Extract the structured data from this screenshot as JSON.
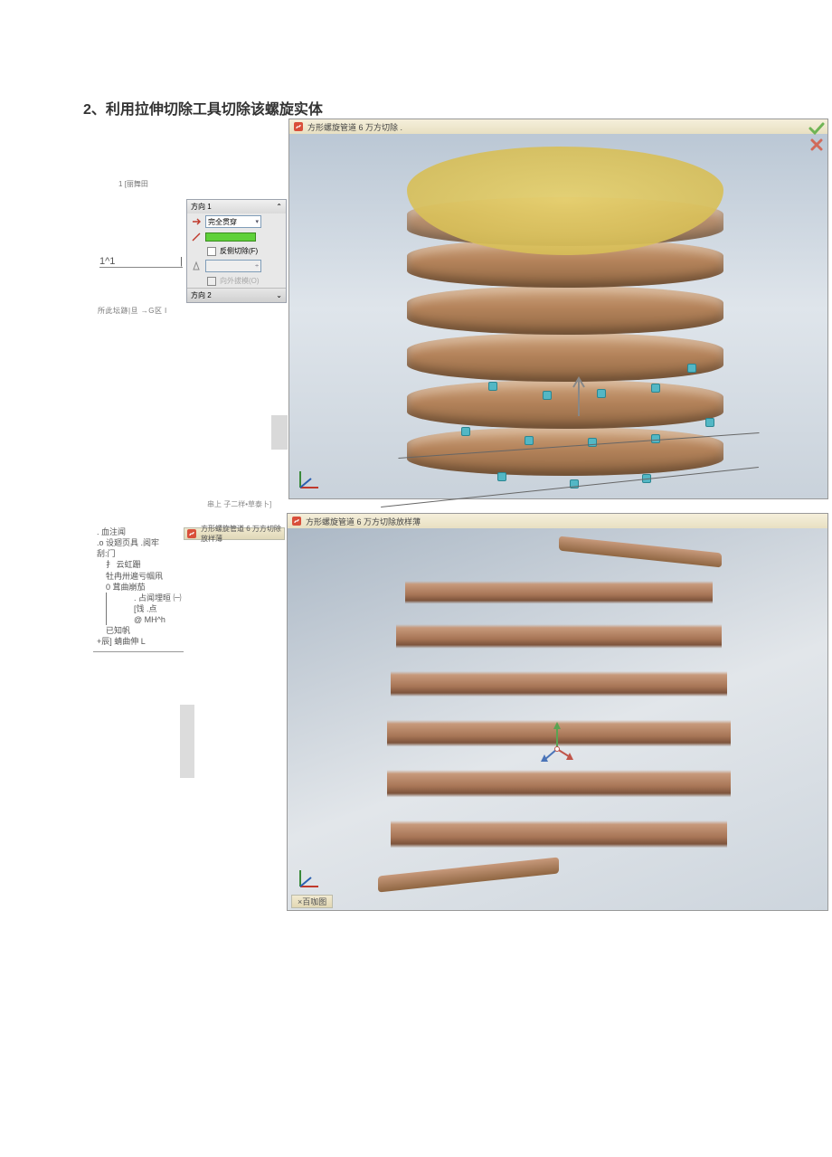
{
  "heading": "2、利用拉伸切除工具切除该螺旋实体",
  "left_top": {
    "label1": "1 [丽舞田",
    "input_prefix": "1^1",
    "input_suffix": "|",
    "label2": "所此坛跡|旦 →G区 l"
  },
  "prop_panel": {
    "header": "方向 1",
    "dropdown_value": "完全贯穿",
    "swatch_color": "#5fd13a",
    "checkbox1_label": "反侧切除(F)",
    "bottom_checkbox": "向外拔模(O)",
    "footer": "方向 2"
  },
  "viewport1": {
    "title": "方形螺旋管道 6 万方切除 .",
    "ok_icon": "check-icon",
    "cancel_icon": "cross-icon"
  },
  "caption1": "串上 子二样•草泰卜]",
  "viewport2": {
    "title": "方形螺旋管道 6 万方切除放样薄",
    "bottom_tab": "×百咖图"
  },
  "tree": {
    "items": [
      {
        "lvl": "l1",
        "txt": ". 血注闻"
      },
      {
        "lvl": "l1",
        "txt": ".o 设廻页具 .阅牢"
      },
      {
        "lvl": "l1",
        "txt": "刮:门"
      },
      {
        "lvl": "l2",
        "txt": "扌 云虹跚"
      },
      {
        "lvl": "l2",
        "txt": "牡冉卅遍亏帼凧"
      },
      {
        "lvl": "l2",
        "txt": "0 茸曲崩茄"
      },
      {
        "lvl": "brace_start",
        "txt": ""
      },
      {
        "lvl": "l3",
        "txt": ". 占闻埋晅 ㈠"
      },
      {
        "lvl": "l3",
        "txt": "[饯 .点"
      },
      {
        "lvl": "l3",
        "txt": "@ MH^h"
      },
      {
        "lvl": "brace_end",
        "txt": ""
      },
      {
        "lvl": "l2",
        "txt": "已知帆"
      },
      {
        "lvl": "l1",
        "txt": "+辰] 蜻曲伸 L"
      }
    ]
  },
  "icons": {
    "sw": "sw-icon",
    "arrow_red": "#cf3b2c",
    "caret": "▾",
    "check": "✓",
    "cross": "✕"
  }
}
